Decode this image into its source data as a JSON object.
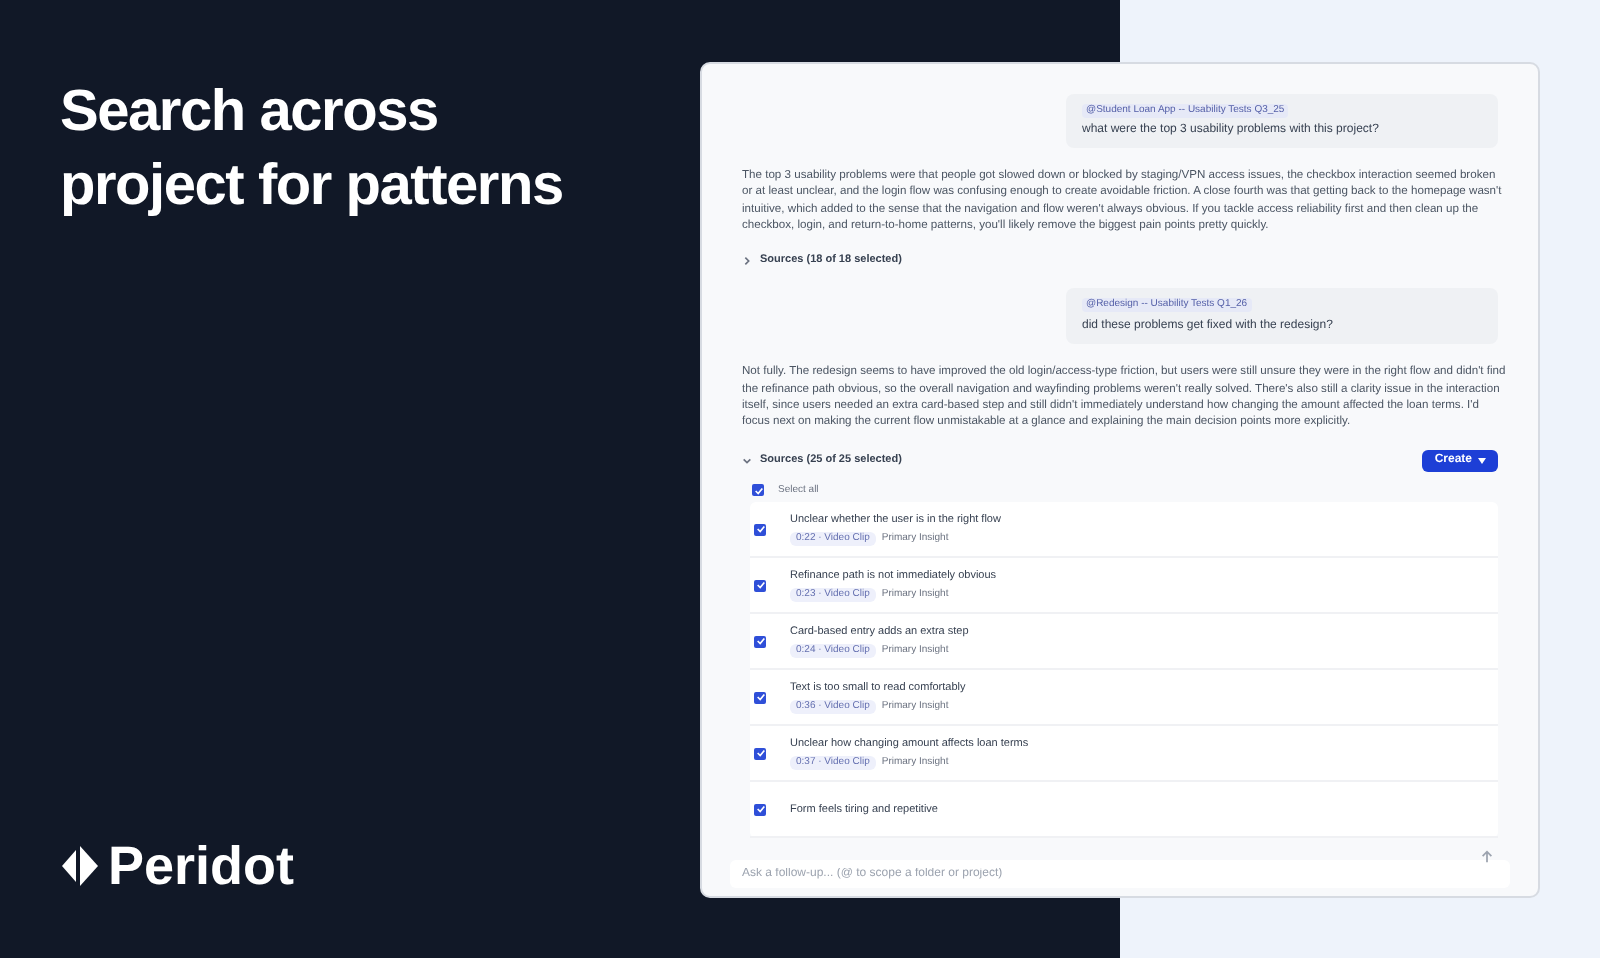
{
  "headline": "Search across project for patterns",
  "brand": "Peridot",
  "chat": [
    {
      "kind": "question",
      "scope": "@Student Loan App -- Usability Tests Q3_25",
      "text": "what were the top 3 usability problems with this project?"
    },
    {
      "kind": "answer",
      "text": "The top 3 usability problems were that people got slowed down or blocked by staging/VPN access issues, the checkbox interaction seemed broken or at least unclear, and the login flow was confusing enough to create avoidable friction. A close fourth was that getting back to the homepage wasn't intuitive, which added to the sense that the navigation and flow weren't always obvious. If you tackle access reliability first and then clean up the checkbox, login, and return-to-home patterns, you'll likely remove the biggest pain points pretty quickly.",
      "sources": {
        "label": "Sources (18 of 18 selected)",
        "expanded": false
      }
    },
    {
      "kind": "question",
      "scope": "@Redesign -- Usability Tests Q1_26",
      "text": "did these problems get fixed with the redesign?"
    },
    {
      "kind": "answer",
      "text": "Not fully. The redesign seems to have improved the old login/access-type friction, but users were still unsure they were in the right flow and didn't find the refinance path obvious, so the overall navigation and wayfinding problems weren't really solved. There's also still a clarity issue in the interaction itself, since users needed an extra card-based step and still didn't immediately understand how changing the amount affected the loan terms. I'd focus next on making the current flow unmistakable at a glance and explaining the main decision points more explicitly.",
      "sources": {
        "label": "Sources (25 of 25 selected)",
        "expanded": true,
        "create": "Create",
        "select_all": {
          "label": "Select all",
          "checked": true
        },
        "items": [
          {
            "title": "Unclear whether the user is in the right flow",
            "clip": "0:22 · Video Clip",
            "tag": "Primary Insight",
            "checked": true
          },
          {
            "title": "Refinance path is not immediately obvious",
            "clip": "0:23 · Video Clip",
            "tag": "Primary Insight",
            "checked": true
          },
          {
            "title": "Card-based entry adds an extra step",
            "clip": "0:24 · Video Clip",
            "tag": "Primary Insight",
            "checked": true
          },
          {
            "title": "Text is too small to read comfortably",
            "clip": "0:36 · Video Clip",
            "tag": "Primary Insight",
            "checked": true
          },
          {
            "title": "Unclear how changing amount affects loan terms",
            "clip": "0:37 · Video Clip",
            "tag": "Primary Insight",
            "checked": true
          },
          {
            "title": "Form feels tiring and repetitive",
            "checked": true
          }
        ]
      }
    }
  ],
  "followup": {
    "placeholder": "Ask a follow-up... (@ to scope a folder or project)"
  }
}
